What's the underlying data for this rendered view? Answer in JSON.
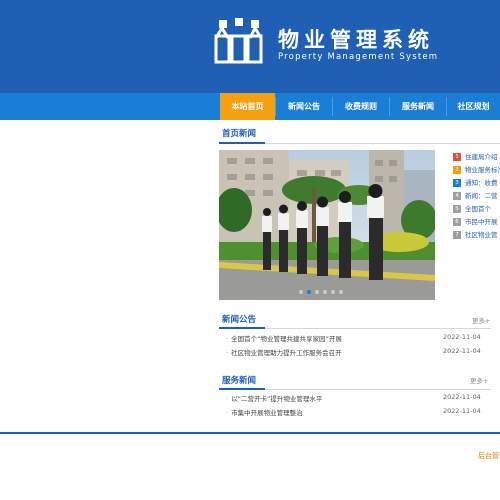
{
  "header": {
    "title": "物业管理系统",
    "subtitle": "Property Management System"
  },
  "nav": {
    "items": [
      {
        "label": "本站首页",
        "active": true
      },
      {
        "label": "新闻公告",
        "active": false
      },
      {
        "label": "收费规则",
        "active": false
      },
      {
        "label": "服务新闻",
        "active": false
      },
      {
        "label": "社区规划",
        "active": false
      }
    ]
  },
  "headlines_section": {
    "title": "首页新闻",
    "items": [
      {
        "num": "1",
        "text": "住建局介绍",
        "color": "#e74c3c"
      },
      {
        "num": "2",
        "text": "物业服务标准",
        "color": "#f39c12"
      },
      {
        "num": "3",
        "text": "通知：收费",
        "color": "#1a7ed6"
      },
      {
        "num": "4",
        "text": "新闻：二营",
        "color": "#9e9e9e"
      },
      {
        "num": "5",
        "text": "全国首个",
        "color": "#9e9e9e"
      },
      {
        "num": "6",
        "text": "市民中开展",
        "color": "#9e9e9e"
      },
      {
        "num": "7",
        "text": "社区物业管",
        "color": "#9e9e9e"
      }
    ]
  },
  "news_section": {
    "title": "新闻公告",
    "more": "更多+",
    "items": [
      {
        "title": "全国首个“物业管理共建共享家园”开展",
        "date": "2022-11-04"
      },
      {
        "title": "社区物业管理助力提升工作服务会召开",
        "date": "2022-11-04"
      }
    ]
  },
  "service_section": {
    "title": "服务新闻",
    "more": "更多+",
    "items": [
      {
        "title": "以“二营开卡”提升物业管理水平",
        "date": "2022-11-04"
      },
      {
        "title": "市集中开展物业管理整治",
        "date": "2022-11-04"
      }
    ]
  },
  "footer": {
    "link": "后台管理"
  },
  "colors": {
    "header_bg": "#1f5fb4",
    "nav_bg": "#1a7ed6",
    "nav_active": "#f5a00f"
  }
}
